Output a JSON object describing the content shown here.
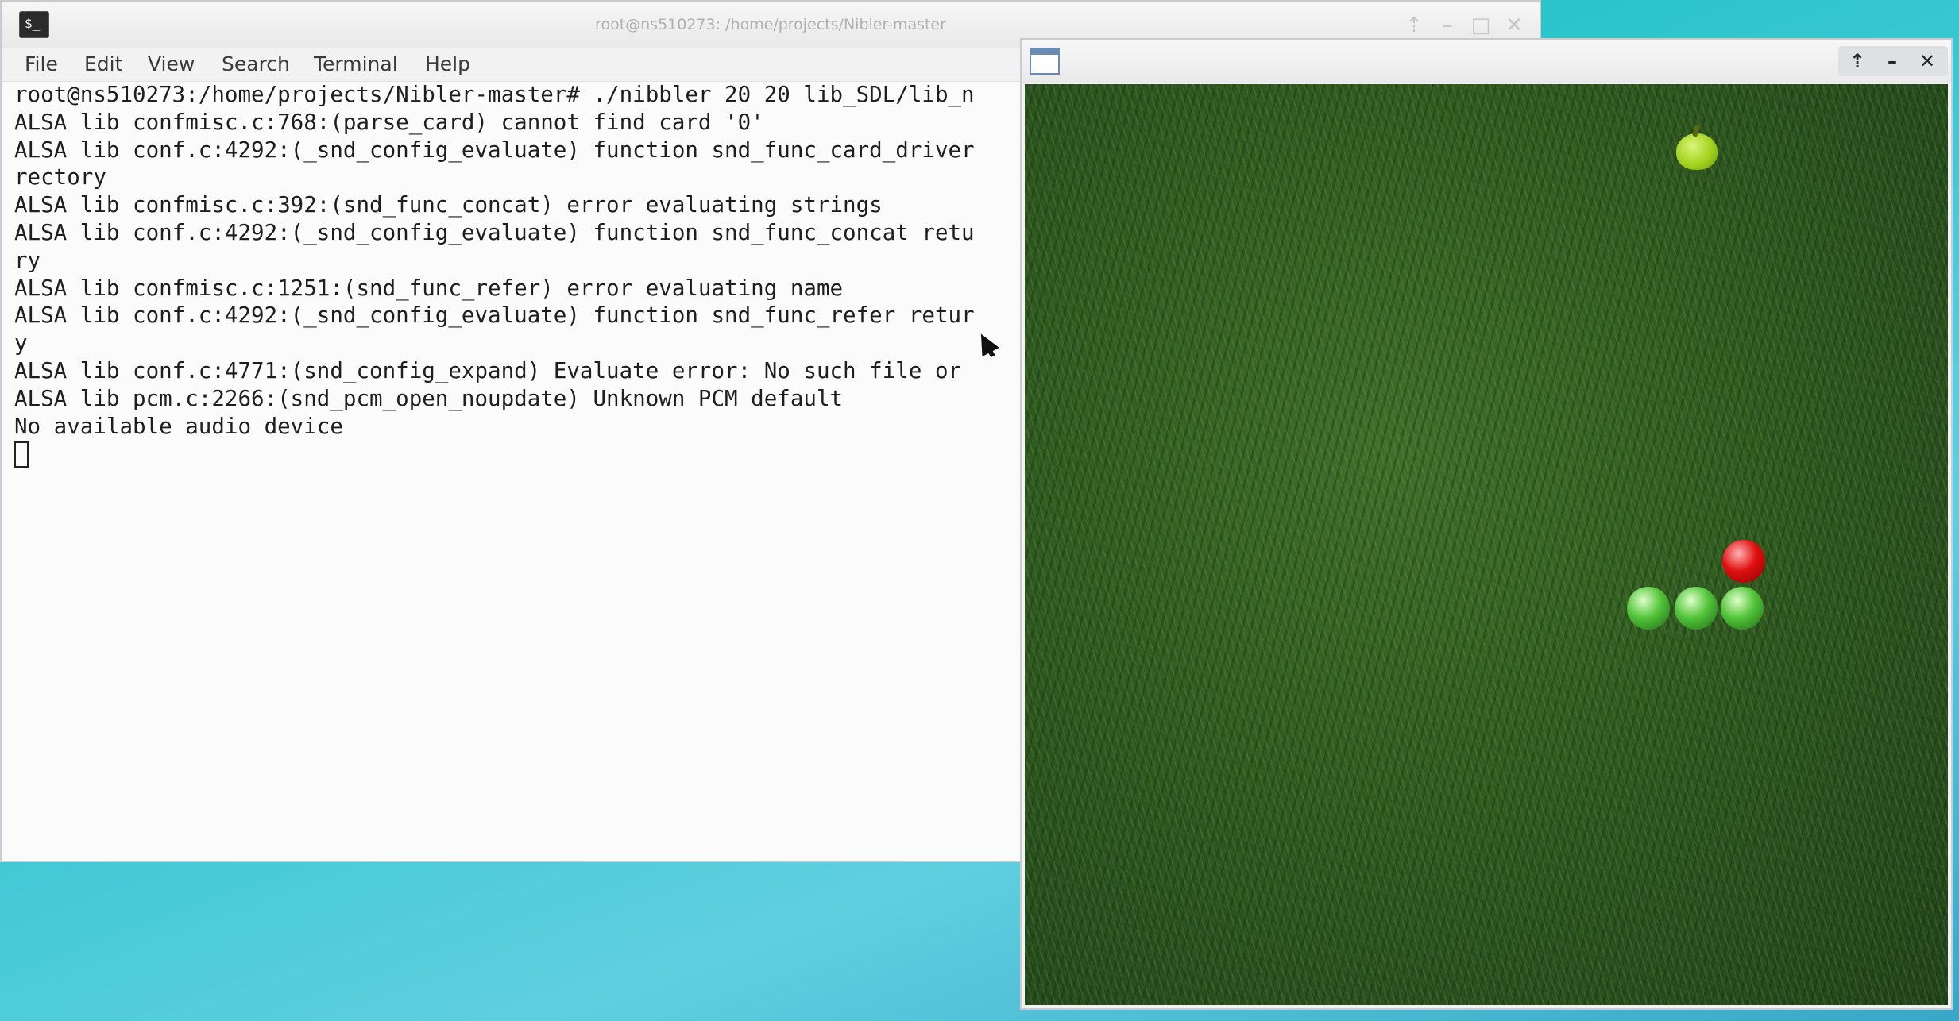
{
  "terminal": {
    "title": "root@ns510273: /home/projects/Nibler-master",
    "menu": [
      "File",
      "Edit",
      "View",
      "Search",
      "Terminal",
      "Help"
    ],
    "lines": [
      "root@ns510273:/home/projects/Nibler-master# ./nibbler 20 20 lib_SDL/lib_n",
      "ALSA lib confmisc.c:768:(parse_card) cannot find card '0'",
      "ALSA lib conf.c:4292:(_snd_config_evaluate) function snd_func_card_driver",
      "rectory",
      "ALSA lib confmisc.c:392:(snd_func_concat) error evaluating strings",
      "ALSA lib conf.c:4292:(_snd_config_evaluate) function snd_func_concat retu",
      "ry",
      "ALSA lib confmisc.c:1251:(snd_func_refer) error evaluating name",
      "ALSA lib conf.c:4292:(_snd_config_evaluate) function snd_func_refer retur",
      "y",
      "ALSA lib conf.c:4771:(snd_config_expand) Evaluate error: No such file or",
      "ALSA lib pcm.c:2266:(snd_pcm_open_noupdate) Unknown PCM default",
      "No available audio device"
    ],
    "titlebar_icons": [
      "pin-icon",
      "minimize-icon",
      "maximize-icon",
      "close-icon"
    ]
  },
  "game_window": {
    "title": "",
    "titlebar_icons": [
      "pin-icon",
      "minimize-icon",
      "close-icon"
    ],
    "background": "grass",
    "apple_color": "#a3d21e",
    "snake_head_color": "#e01010",
    "snake_body_color": "#52c43a"
  }
}
